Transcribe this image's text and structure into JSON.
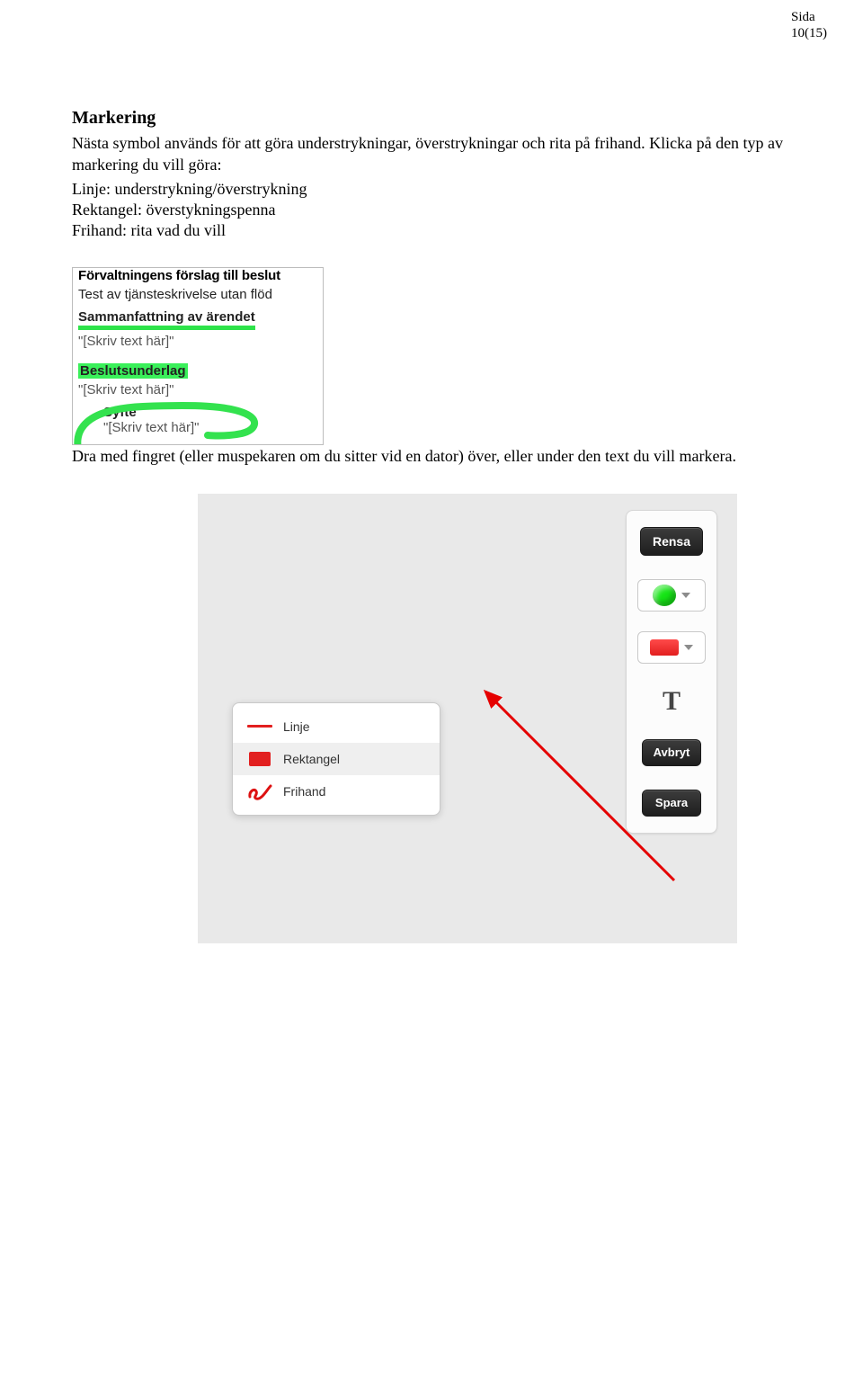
{
  "header": {
    "label": "Sida",
    "page": "10(15)"
  },
  "section": {
    "title": "Markering",
    "intro": "Nästa symbol används för att göra understrykningar, överstrykningar och rita på frihand. Klicka på den typ av markering du vill göra:",
    "bullets": {
      "linje": "Linje: understrykning/överstrykning",
      "rekt": "Rektangel: överstykningspenna",
      "fri": "Frihand: rita vad du vill"
    }
  },
  "shot1": {
    "truncated_top": "Förvaltningens förslag till beslut",
    "test_line": "Test av tjänsteskrivelse utan flöd",
    "samman": "Sammanfattning av ärendet",
    "placeholder": "\"[Skriv text här]\"",
    "beslut": "Beslutsunderlag",
    "syfte": "Syfte"
  },
  "mid": "Dra med fingret (eller muspekaren om du sitter vid en dator) över, eller under den text du vill markera.",
  "toolbar": {
    "rensa": "Rensa",
    "text_tool": "T",
    "avbryt": "Avbryt",
    "spara": "Spara"
  },
  "popup": {
    "linje": "Linje",
    "rekt": "Rektangel",
    "fri": "Frihand"
  }
}
